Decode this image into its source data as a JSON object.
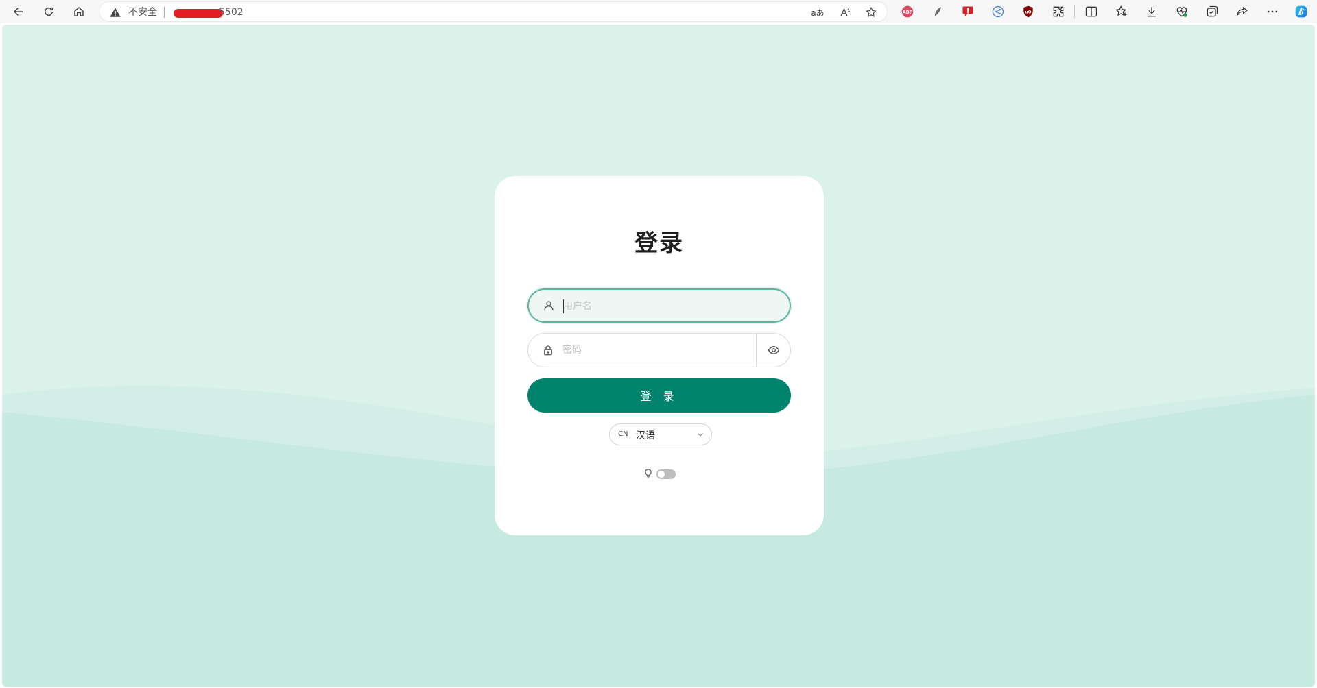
{
  "browser": {
    "security_label": "不安全",
    "url_suffix": "5502",
    "reader_icon": "read-aloud-icon",
    "translate_icon": "translate-icon",
    "favorite_icon": "star-icon",
    "extensions": [
      "adblock-plus-icon",
      "feather-extension-icon",
      "thumbs-down-extension-icon",
      "share-extension-icon",
      "ublock-origin-icon",
      "extensions-puzzle-icon"
    ],
    "toolbar_icons": [
      "split-screen-icon",
      "favorites-icon",
      "download-icon",
      "performance-icon",
      "collections-icon",
      "share-icon",
      "more-icon",
      "copilot-icon"
    ]
  },
  "login": {
    "title": "登录",
    "username_placeholder": "用户名",
    "password_placeholder": "密码",
    "submit_label": "登 录",
    "language": {
      "code": "CN",
      "label": "汉语"
    },
    "theme_toggle": {
      "icon": "bulb-icon",
      "on": false
    }
  },
  "colors": {
    "accent": "#00836d",
    "page_bg": "#dbf2ea",
    "wave_bg": "#c6e9e0"
  }
}
